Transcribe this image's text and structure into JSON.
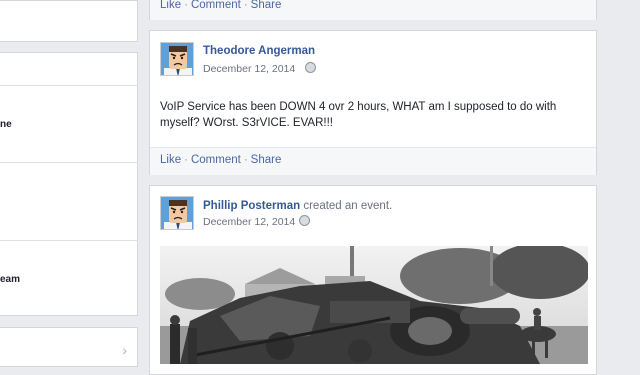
{
  "sidebar": {
    "items": [
      {
        "label": "ne"
      },
      {
        "label": "eam"
      }
    ]
  },
  "feed": {
    "top_actions": {
      "like": "Like",
      "comment": "Comment",
      "share": "Share",
      "separator": "·"
    },
    "posts": [
      {
        "author": "Theodore Angerman",
        "date": "December 12, 2014",
        "text": "VoIP Service has been DOWN 4 ovr 2 hours, WHAT am I supposed to do with myself? WOrst. S3rVICE. EVAR!!!",
        "actions": {
          "like": "Like",
          "comment": "Comment",
          "share": "Share"
        }
      },
      {
        "author": "Phillip Posterman",
        "verb": "created an event.",
        "date": "December 12, 2014"
      }
    ]
  },
  "icons": [
    "avatar-angry",
    "globe-icon",
    "chevron-right-icon"
  ],
  "colors": {
    "link": "#365899",
    "background": "#e9ebee",
    "action_bar": "#f6f7f9"
  }
}
